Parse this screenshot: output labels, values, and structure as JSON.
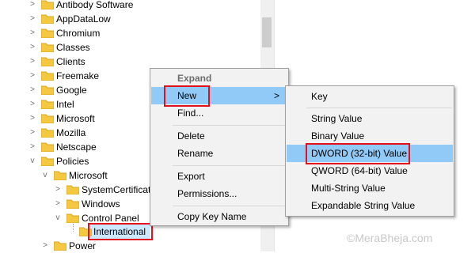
{
  "tree": {
    "items": [
      {
        "label": "Antibody Software",
        "arrow": ">"
      },
      {
        "label": "AppDataLow",
        "arrow": ">"
      },
      {
        "label": "Chromium",
        "arrow": ">"
      },
      {
        "label": "Classes",
        "arrow": ">"
      },
      {
        "label": "Clients",
        "arrow": ">"
      },
      {
        "label": "Freemake",
        "arrow": ">"
      },
      {
        "label": "Google",
        "arrow": ">"
      },
      {
        "label": "Intel",
        "arrow": ">"
      },
      {
        "label": "Microsoft",
        "arrow": ">"
      },
      {
        "label": "Mozilla",
        "arrow": ">"
      },
      {
        "label": "Netscape",
        "arrow": ">"
      },
      {
        "label": "Policies",
        "arrow": "v"
      },
      {
        "label": "Microsoft",
        "arrow": "v"
      },
      {
        "label": "SystemCertificat",
        "arrow": ">"
      },
      {
        "label": "Windows",
        "arrow": ">"
      },
      {
        "label": "Control Panel",
        "arrow": "v"
      },
      {
        "label": "International",
        "arrow": ""
      },
      {
        "label": "Power",
        "arrow": ">"
      }
    ]
  },
  "context_menu": {
    "expand": "Expand",
    "new": "New",
    "find": "Find...",
    "delete": "Delete",
    "rename": "Rename",
    "export": "Export",
    "permissions": "Permissions...",
    "copy_key_name": "Copy Key Name",
    "submenu_arrow": ">"
  },
  "submenu": {
    "key": "Key",
    "string_value": "String Value",
    "binary_value": "Binary Value",
    "dword_value": "DWORD (32-bit) Value",
    "qword_value": "QWORD (64-bit) Value",
    "multi_string_value": "Multi-String Value",
    "expandable_string_value": "Expandable String Value"
  },
  "watermark": "©MeraBheja.com",
  "colors": {
    "highlight": "#91c9f7",
    "selection": "#cce8ff",
    "annotation_red": "#e2111c",
    "folder": "#f5c842"
  }
}
